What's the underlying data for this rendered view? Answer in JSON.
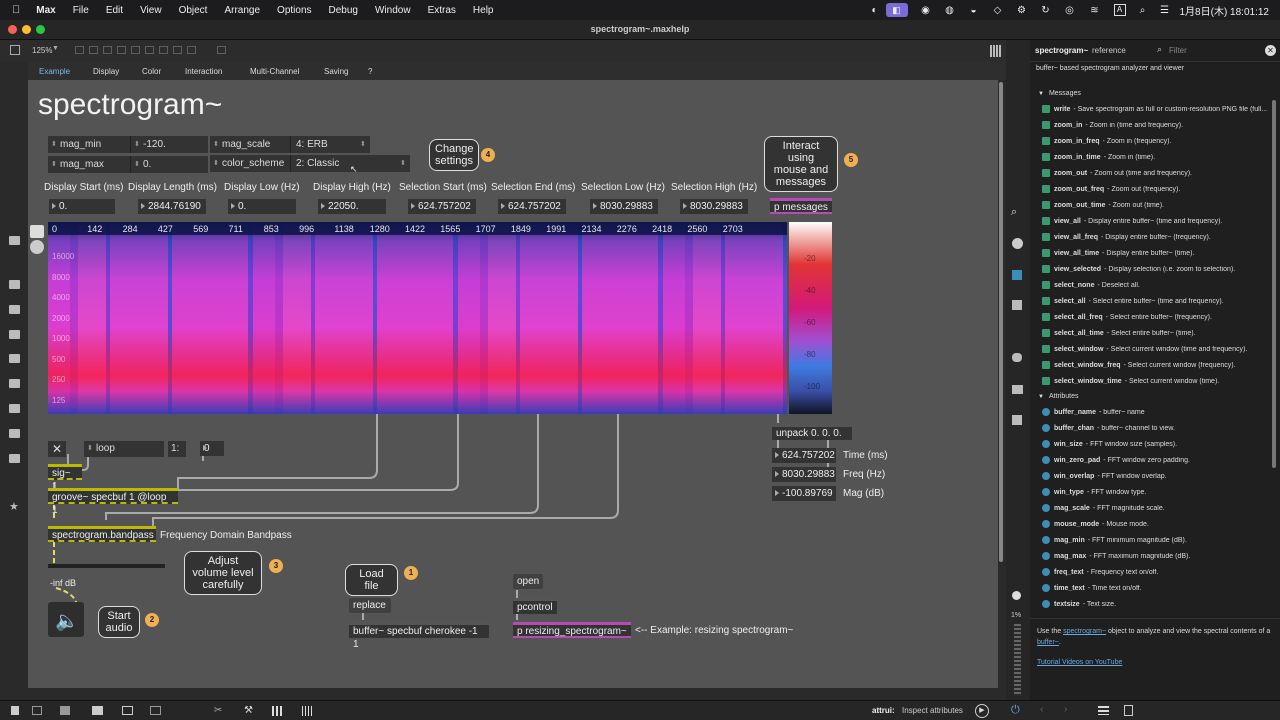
{
  "menubar": {
    "app": "Max",
    "items": [
      "File",
      "Edit",
      "View",
      "Object",
      "Arrange",
      "Options",
      "Debug",
      "Window",
      "Extras",
      "Help"
    ],
    "clock": "1月8日(木) 18:01:12"
  },
  "window": {
    "title": "spectrogram~.maxhelp",
    "zoom": "125%"
  },
  "tabs": [
    "Example",
    "Display",
    "Color",
    "Interaction",
    "Multi-Channel",
    "Saving",
    "?"
  ],
  "patch": {
    "title": "spectrogram~",
    "attrs": {
      "mag_min": "mag_min",
      "mag_min_val": "-120.",
      "mag_max": "mag_max",
      "mag_max_val": "0.",
      "mag_scale": "mag_scale",
      "mag_scale_val": "4: ERB",
      "color_scheme": "color_scheme",
      "color_scheme_val": "2: Classic"
    },
    "callouts": {
      "change": "Change settings",
      "interact": "Interact using mouse and messages",
      "volume": "Adjust volume level carefully",
      "start": "Start audio",
      "load": "Load file"
    },
    "badges": [
      "4",
      "5",
      "3",
      "2",
      "1"
    ],
    "display_labels": [
      "Display Start (ms)",
      "Display Length (ms)",
      "Display Low (Hz)",
      "Display High (Hz)",
      "Selection Start (ms)",
      "Selection End (ms)",
      "Selection Low (Hz)",
      "Selection High (Hz)"
    ],
    "display_values": [
      "0.",
      "2844.76190",
      "0.",
      "22050.",
      "624.757202",
      "624.757202",
      "8030.29883",
      "8030.29883"
    ],
    "p_messages": "p messages",
    "time_ticks": [
      "0",
      "142",
      "284",
      "427",
      "569",
      "711",
      "853",
      "996",
      "1138",
      "1280",
      "1422",
      "1565",
      "1707",
      "1849",
      "1991",
      "2134",
      "2276",
      "2418",
      "2560",
      "2703"
    ],
    "freq_ticks": [
      "16000",
      "8000",
      "4000",
      "2000",
      "1000",
      "500",
      "250",
      "125"
    ],
    "scale_ticks": [
      "-20",
      "-40",
      "-60",
      "-80",
      "-100"
    ],
    "unpack": "unpack 0. 0. 0.",
    "readouts": [
      {
        "value": "624.757202",
        "label": "Time (ms)"
      },
      {
        "value": "8030.29883",
        "label": "Freq (Hz)"
      },
      {
        "value": "-100.89769",
        "label": "Mag (dB)"
      }
    ],
    "loop": "loop",
    "loop_num": "1:",
    "loop_val": "0",
    "sig": "sig~ 1",
    "groove": "groove~ specbuf 1 @loop 1",
    "bandpass": "spectrogram.bandpass",
    "bandpass_label": "Frequency Domain Bandpass",
    "gain_db": "-inf dB",
    "replace": "replace",
    "buffer": "buffer~ specbuf cherokee -1 1",
    "open": "open",
    "pcontrol": "pcontrol",
    "p_resize": "p resizing_spectrogram~",
    "resize_comment": "<-- Example: resizing spectrogram~"
  },
  "reference": {
    "title_obj": "spectrogram~",
    "title_ref": "reference",
    "filter": "Filter",
    "desc": "buffer~ based spectrogram analyzer and viewer",
    "messages_header": "Messages",
    "messages": [
      {
        "n": "write",
        "d": "- Save spectrogram as full or custom-resolution PNG file (full..."
      },
      {
        "n": "zoom_in",
        "d": "- Zoom in (time and frequency)."
      },
      {
        "n": "zoom_in_freq",
        "d": "- Zoom in (frequency)."
      },
      {
        "n": "zoom_in_time",
        "d": "- Zoom in (time)."
      },
      {
        "n": "zoom_out",
        "d": "- Zoom out (time and frequency)."
      },
      {
        "n": "zoom_out_freq",
        "d": "- Zoom out (frequency)."
      },
      {
        "n": "zoom_out_time",
        "d": "- Zoom out (time)."
      },
      {
        "n": "view_all",
        "d": "- Display entire buffer~ (time and frequency)."
      },
      {
        "n": "view_all_freq",
        "d": "- Display entire buffer~ (frequency)."
      },
      {
        "n": "view_all_time",
        "d": "- Display entire buffer~ (time)."
      },
      {
        "n": "view_selected",
        "d": "- Display selection (i.e. zoom to selection)."
      },
      {
        "n": "select_none",
        "d": "- Deselect all."
      },
      {
        "n": "select_all",
        "d": "- Select entire buffer~ (time and frequency)."
      },
      {
        "n": "select_all_freq",
        "d": "- Select entire buffer~ (frequency)."
      },
      {
        "n": "select_all_time",
        "d": "- Select entire buffer~ (time)."
      },
      {
        "n": "select_window",
        "d": "- Select current window (time and frequency)."
      },
      {
        "n": "select_window_freq",
        "d": "- Select current window (frequency)."
      },
      {
        "n": "select_window_time",
        "d": "- Select current window (time)."
      }
    ],
    "attributes_header": "Attributes",
    "attributes": [
      {
        "n": "buffer_name",
        "d": "- buffer~ name"
      },
      {
        "n": "buffer_chan",
        "d": "- buffer~ channel to view."
      },
      {
        "n": "win_size",
        "d": "- FFT window size (samples)."
      },
      {
        "n": "win_zero_pad",
        "d": "- FFT window zero padding."
      },
      {
        "n": "win_overlap",
        "d": "- FFT window overlap."
      },
      {
        "n": "win_type",
        "d": "- FFT window type."
      },
      {
        "n": "mag_scale",
        "d": "- FFT magnitude scale."
      },
      {
        "n": "mouse_mode",
        "d": "- Mouse mode."
      },
      {
        "n": "mag_min",
        "d": "- FFT minimum magnitude (dB)."
      },
      {
        "n": "mag_max",
        "d": "- FFT maximum magnitude (dB)."
      },
      {
        "n": "freq_text",
        "d": "- Frequency text on/off."
      },
      {
        "n": "time_text",
        "d": "- Time text on/off."
      },
      {
        "n": "textsize",
        "d": "- Text size."
      }
    ],
    "footer_pre": "Use the",
    "footer_link1": "spectrogram~",
    "footer_mid": "object to analyze and view the spectral contents of a",
    "footer_link2": "buffer~",
    "footer_end": ".",
    "tutorial": "Tutorial Videos on YouTube"
  },
  "rightbar_pct": "1%",
  "status": {
    "obj": "attrui:",
    "text": "Inspect attributes"
  }
}
